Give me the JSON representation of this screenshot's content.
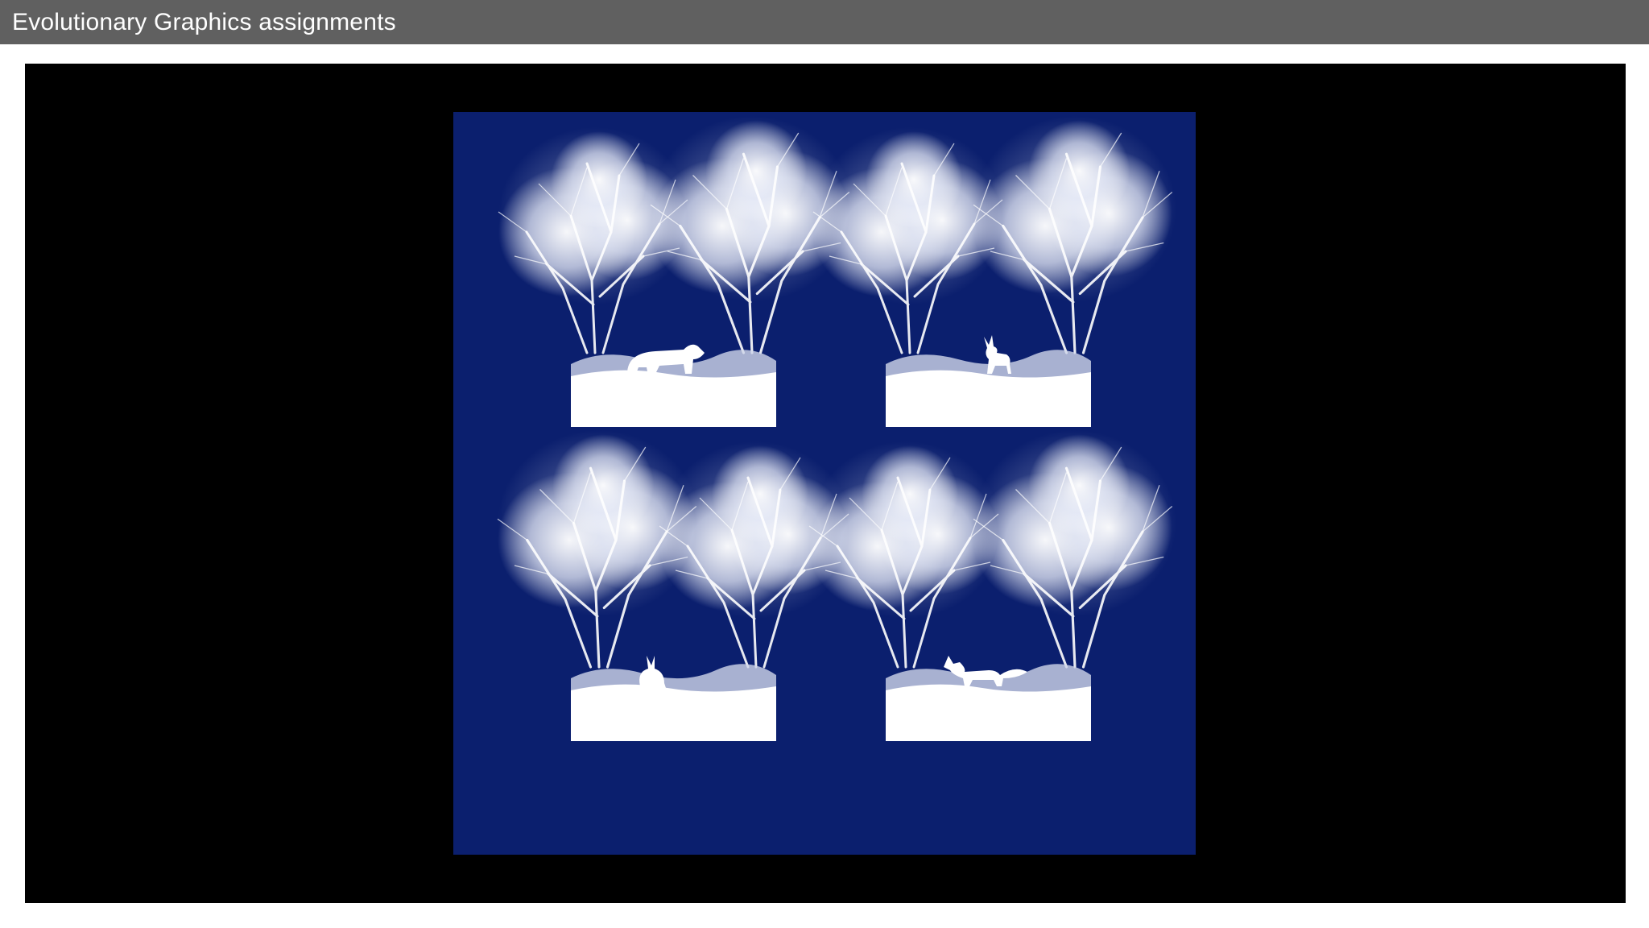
{
  "window": {
    "title": "Evolutionary Graphics assignments"
  },
  "artwork": {
    "background_color": "#0b1f6e",
    "foreground_color": "#ffffff",
    "panels": [
      {
        "id": "panel-top-left",
        "animal": "bear"
      },
      {
        "id": "panel-top-right",
        "animal": "deer"
      },
      {
        "id": "panel-bottom-left",
        "animal": "rabbit"
      },
      {
        "id": "panel-bottom-right",
        "animal": "fox"
      }
    ]
  }
}
